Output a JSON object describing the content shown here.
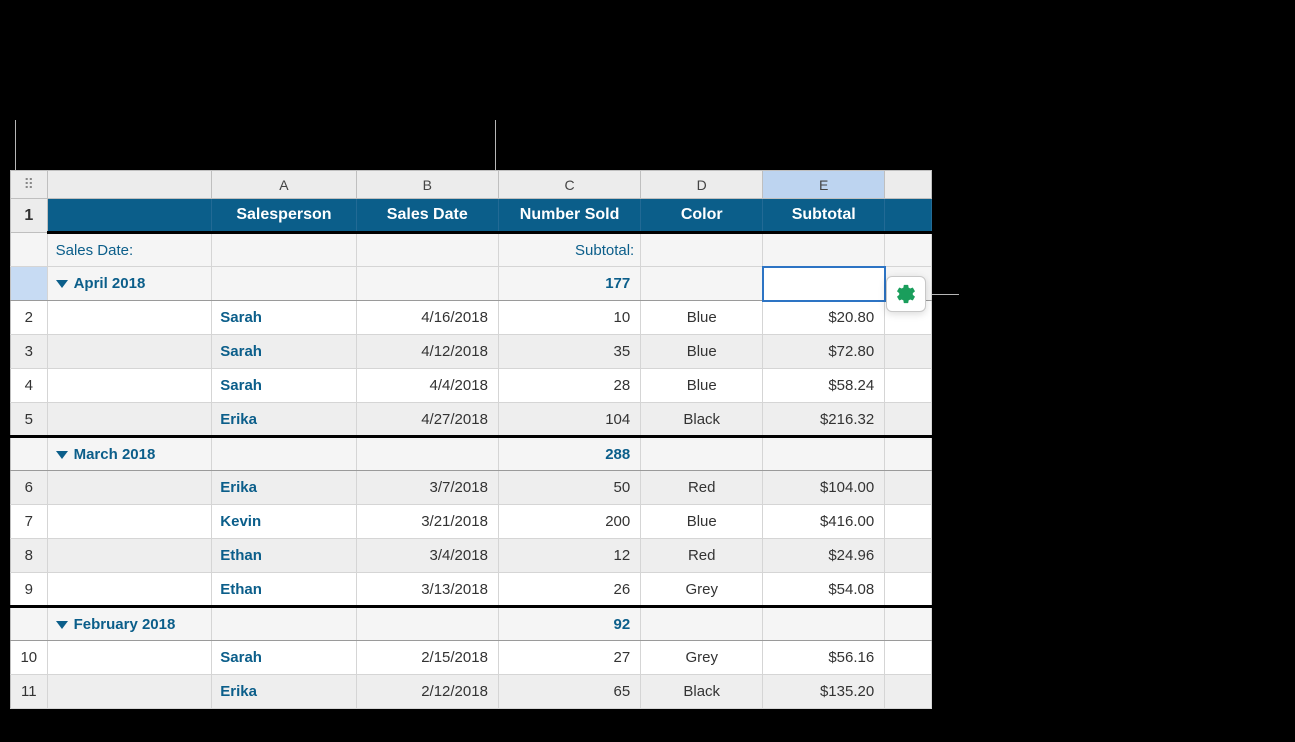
{
  "columns": {
    "num": "1",
    "letters": [
      "A",
      "B",
      "C",
      "D",
      "E"
    ]
  },
  "headers": [
    "Salesperson",
    "Sales Date",
    "Number Sold",
    "Color",
    "Subtotal"
  ],
  "summary_labels": {
    "left": "Sales Date:",
    "right": "Subtotal:"
  },
  "groups": [
    {
      "label": "April 2018",
      "sum": "177",
      "selected": true,
      "rows": [
        {
          "n": "2",
          "p": "Sarah",
          "d": "4/16/2018",
          "q": "10",
          "c": "Blue",
          "m": "$20.80",
          "alt": "odd"
        },
        {
          "n": "3",
          "p": "Sarah",
          "d": "4/12/2018",
          "q": "35",
          "c": "Blue",
          "m": "$72.80",
          "alt": "even"
        },
        {
          "n": "4",
          "p": "Sarah",
          "d": "4/4/2018",
          "q": "28",
          "c": "Blue",
          "m": "$58.24",
          "alt": "odd"
        },
        {
          "n": "5",
          "p": "Erika",
          "d": "4/27/2018",
          "q": "104",
          "c": "Black",
          "m": "$216.32",
          "alt": "even",
          "last": true
        }
      ]
    },
    {
      "label": "March 2018",
      "sum": "288",
      "rows": [
        {
          "n": "6",
          "p": "Erika",
          "d": "3/7/2018",
          "q": "50",
          "c": "Red",
          "m": "$104.00",
          "alt": "even"
        },
        {
          "n": "7",
          "p": "Kevin",
          "d": "3/21/2018",
          "q": "200",
          "c": "Blue",
          "m": "$416.00",
          "alt": "odd"
        },
        {
          "n": "8",
          "p": "Ethan",
          "d": "3/4/2018",
          "q": "12",
          "c": "Red",
          "m": "$24.96",
          "alt": "even"
        },
        {
          "n": "9",
          "p": "Ethan",
          "d": "3/13/2018",
          "q": "26",
          "c": "Grey",
          "m": "$54.08",
          "alt": "odd",
          "last": true
        }
      ]
    },
    {
      "label": "February 2018",
      "sum": "92",
      "rows": [
        {
          "n": "10",
          "p": "Sarah",
          "d": "2/15/2018",
          "q": "27",
          "c": "Grey",
          "m": "$56.16",
          "alt": "odd"
        },
        {
          "n": "11",
          "p": "Erika",
          "d": "2/12/2018",
          "q": "65",
          "c": "Black",
          "m": "$135.20",
          "alt": "even"
        }
      ]
    }
  ]
}
